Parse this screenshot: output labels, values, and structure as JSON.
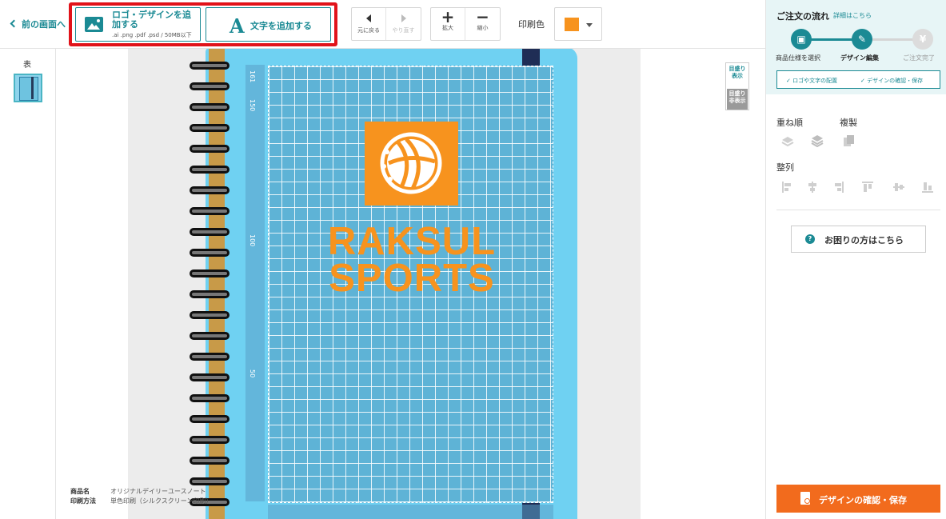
{
  "toolbar": {
    "back_label": "前の画面へ",
    "add_logo_label": "ロゴ・デザインを追加する",
    "add_logo_formats": ".ai .png .pdf .psd / 50MB以下",
    "add_text_label": "文字を追加する",
    "undo_label": "元に戻る",
    "redo_label": "やり直す",
    "zoom_in_label": "拡大",
    "zoom_out_label": "縮小",
    "print_color_label": "印刷色",
    "print_color_value": "#f7931e"
  },
  "pages": {
    "front_label": "表"
  },
  "canvas": {
    "ruler_numbers": [
      "161",
      "150",
      "100",
      "50"
    ],
    "brand_line1": "RAKSUL",
    "brand_line2": "SPORTS",
    "brand_color": "#f7931e",
    "guide_show_label": "目盛り表示",
    "guide_hide_label": "目盛り非表示",
    "product_name_key": "商品名",
    "product_name_value": "オリジナルデイリーユースノート",
    "print_method_key": "印刷方法",
    "print_method_value": "単色印刷（シルクスクリーン印刷）"
  },
  "panel": {
    "flow_title": "ご注文の流れ",
    "flow_link": "詳細はこちら",
    "steps": [
      {
        "label": "商品仕様を選択",
        "icon": "gift-icon",
        "state": "done"
      },
      {
        "label": "デザイン編集",
        "icon": "pencil-icon",
        "state": "current"
      },
      {
        "label": "ご注文完了",
        "icon": "yen-icon",
        "state": "todo"
      }
    ],
    "substep1": "✓ ロゴや文字の配置",
    "substep2": "✓ デザインの確認・保存",
    "layer_order_label": "重ね順",
    "duplicate_label": "複製",
    "align_label": "整列",
    "help_label": "お困りの方はこちら",
    "confirm_label": "デザインの確認・保存",
    "accent_color": "#1b8a94",
    "confirm_color": "#f26b1d"
  }
}
